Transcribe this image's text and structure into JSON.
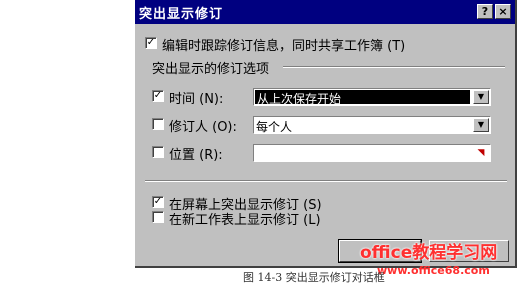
{
  "dialog": {
    "title": "突出显示修订",
    "help_button": "?",
    "close_button": "×",
    "track_changes": {
      "checked": true,
      "label": "编辑时跟踪修订信息，同时共享工作簿 (T)"
    },
    "group_title": "突出显示的修订选项",
    "when": {
      "checked": true,
      "label": "时间 (N):",
      "value": "从上次保存开始"
    },
    "who": {
      "checked": false,
      "label": "修订人 (O):",
      "value": "每个人"
    },
    "where": {
      "checked": false,
      "label": "位置 (R):",
      "value": ""
    },
    "highlight_on_screen": {
      "checked": true,
      "label": "在屏幕上突出显示修订 (S)"
    },
    "list_on_new_sheet": {
      "checked": false,
      "label": "在新工作表上显示修订 (L)"
    }
  },
  "watermark": {
    "text": "office教程学习网",
    "url": "www.office68.com"
  },
  "caption": "图 14-3  突出显示修订对话框"
}
